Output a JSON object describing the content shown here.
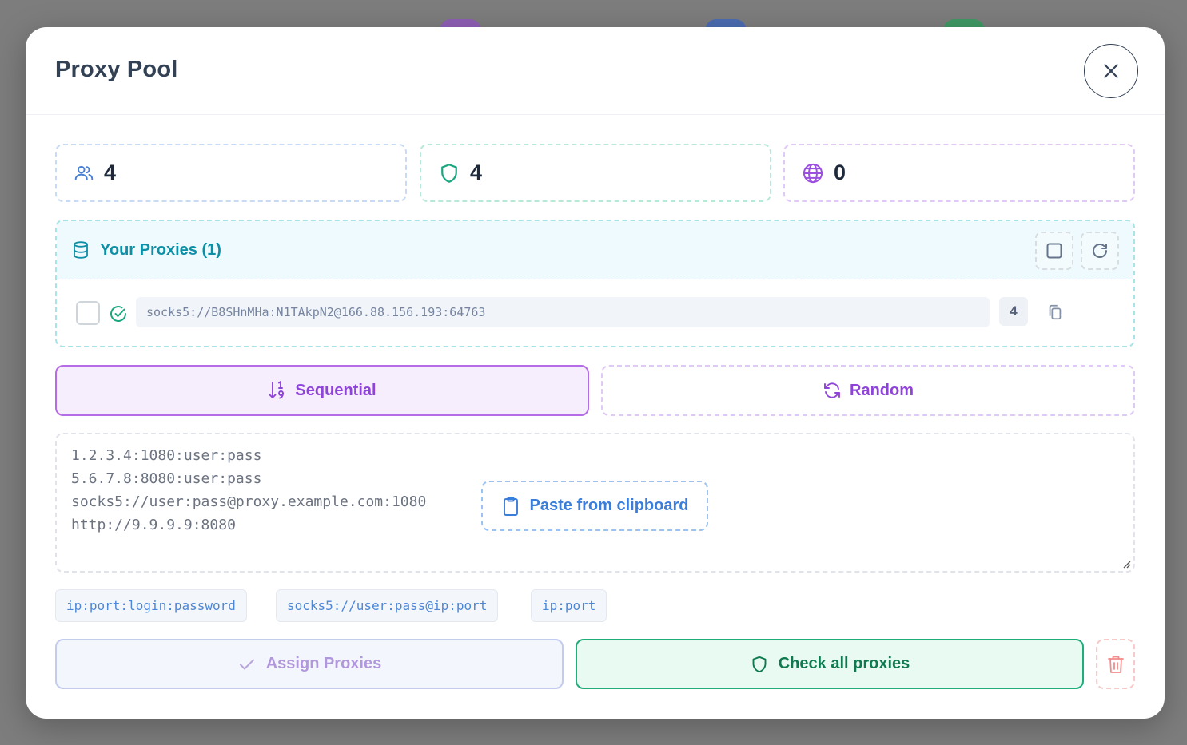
{
  "modal": {
    "title": "Proxy Pool"
  },
  "stats": [
    {
      "icon": "users-icon",
      "value": "4",
      "color": "#4a7fd6"
    },
    {
      "icon": "shield-icon",
      "value": "4",
      "color": "#1aa67e"
    },
    {
      "icon": "globe-icon",
      "value": "0",
      "color": "#9b4fe0"
    }
  ],
  "proxies": {
    "title": "Your Proxies (1)",
    "items": [
      {
        "url": "socks5://B8SHnMHa:N1TAkpN2@166.88.156.193:64763",
        "count": "4",
        "status": "valid"
      }
    ]
  },
  "modes": {
    "sequential_label": "Sequential",
    "random_label": "Random",
    "selected": "Sequential"
  },
  "input": {
    "placeholder_lines": [
      "1.2.3.4:1080:user:pass",
      "5.6.7.8:8080:user:pass",
      "socks5://user:pass@proxy.example.com:1080",
      "http://9.9.9.9:8080"
    ],
    "paste_label": "Paste from clipboard"
  },
  "formats": [
    "ip:port:login:password",
    "socks5://user:pass@ip:port",
    "ip:port"
  ],
  "actions": {
    "assign_label": "Assign Proxies",
    "check_label": "Check all proxies"
  },
  "colors": {
    "accent_teal": "#0e8fa6",
    "accent_purple": "#8e44d8",
    "accent_green": "#0f7a4f",
    "accent_blue": "#3b7ddb",
    "danger": "#f28b8b"
  }
}
